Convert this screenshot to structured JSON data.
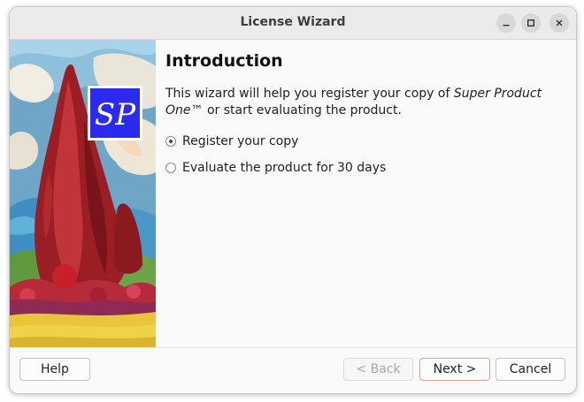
{
  "window": {
    "title": "License Wizard",
    "controls": {
      "minimize_icon": "minimize-icon",
      "maximize_icon": "maximize-icon",
      "close_icon": "close-icon"
    }
  },
  "banner": {
    "logo_text": "SP",
    "logo_colors": {
      "background": "#2a2af0",
      "border": "#ffffff",
      "text": "#ffffff"
    }
  },
  "page": {
    "heading": "Introduction",
    "intro_prefix": "This wizard will help you register your copy of ",
    "product_name": "Super Product One",
    "intro_suffix": "™ or start evaluating the product."
  },
  "options": [
    {
      "label": "Register your copy",
      "selected": true
    },
    {
      "label": "Evaluate the product for 30 days",
      "selected": false
    }
  ],
  "buttons": {
    "help": "Help",
    "back": "< Back",
    "next": "Next >",
    "cancel": "Cancel"
  },
  "colors": {
    "default_button_border": "#e8a090",
    "titlebar": "#ebebeb"
  }
}
